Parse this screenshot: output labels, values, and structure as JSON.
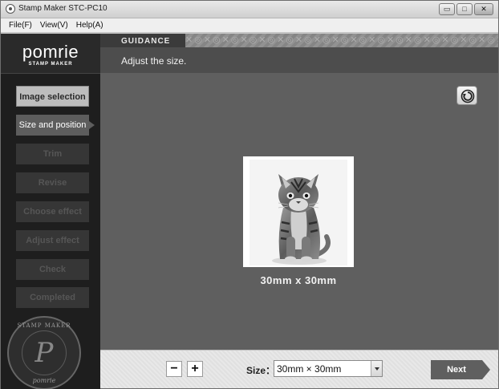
{
  "window": {
    "title": "Stamp Maker STC-PC10",
    "minimize": "▭",
    "maximize": "□",
    "close": "✕"
  },
  "menu": [
    "File(F)",
    "View(V)",
    "Help(A)"
  ],
  "logo": {
    "main": "pomrie",
    "sub": "STAMP MAKER"
  },
  "steps": [
    {
      "label": "Image selection",
      "state": "done"
    },
    {
      "label": "Size and position",
      "state": "active"
    },
    {
      "label": "Trim",
      "state": "todo"
    },
    {
      "label": "Revise",
      "state": "todo"
    },
    {
      "label": "Choose effect",
      "state": "todo"
    },
    {
      "label": "Adjust effect",
      "state": "todo"
    },
    {
      "label": "Check",
      "state": "todo"
    },
    {
      "label": "Completed",
      "state": "todo"
    }
  ],
  "seal": {
    "top": "STAMP MAKER",
    "letter": "P",
    "bottom": "pomrie"
  },
  "guidance": {
    "label": "GUIDANCE",
    "text": "Adjust the size."
  },
  "preview": {
    "size_caption": "30mm x 30mm"
  },
  "controls": {
    "minus": "−",
    "plus": "+",
    "size_label": "Size：",
    "size_value": "30mm × 30mm",
    "next": "Next"
  },
  "colors": {
    "sidebar": "#1e1e1e",
    "main": "#5f5f5f",
    "guidance": "#4d4d4d"
  }
}
